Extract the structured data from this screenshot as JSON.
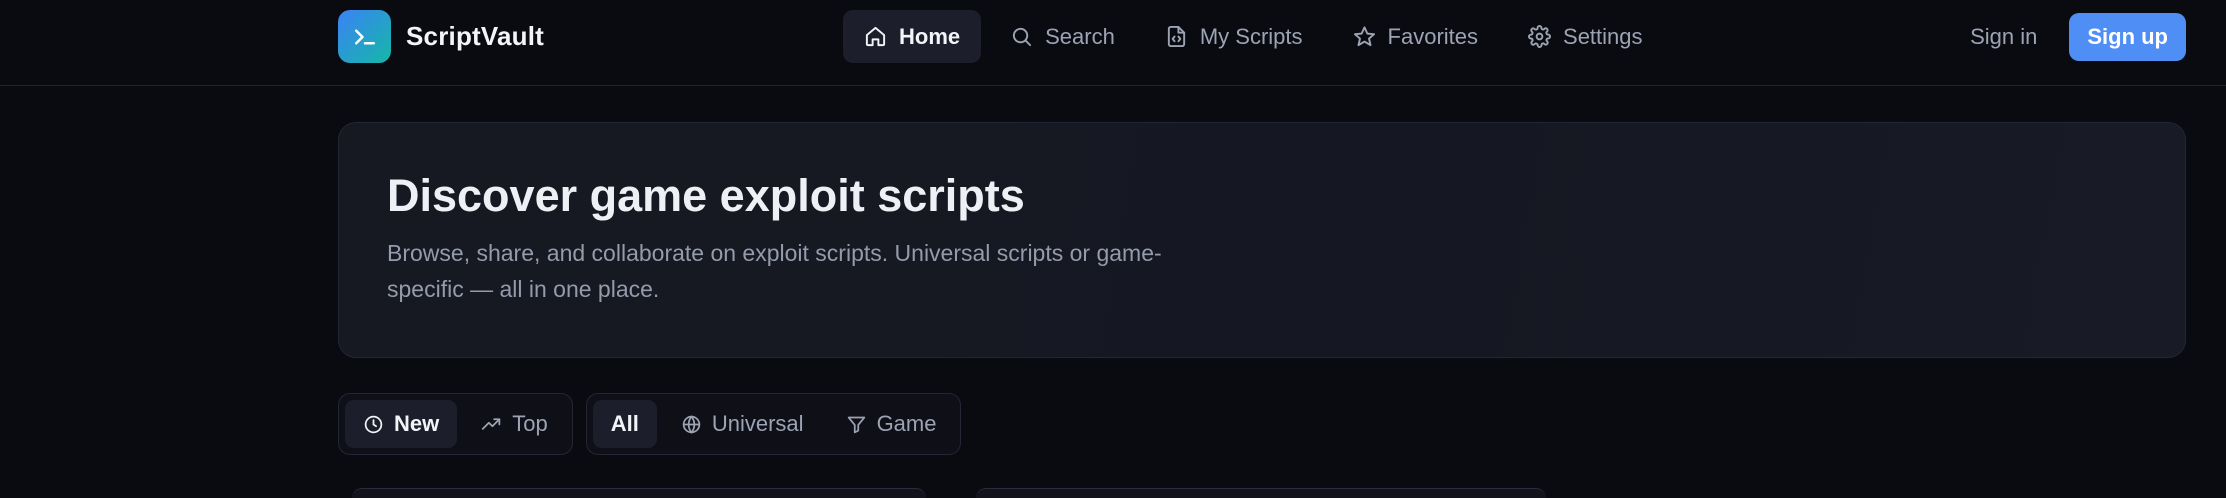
{
  "brand": {
    "name": "ScriptVault",
    "logo_icon": "terminal-icon",
    "gradient_from": "#3b82f6",
    "gradient_to": "#14b8a6"
  },
  "nav": {
    "items": [
      {
        "label": "Home",
        "icon": "home-icon",
        "active": true
      },
      {
        "label": "Search",
        "icon": "search-icon",
        "active": false
      },
      {
        "label": "My Scripts",
        "icon": "file-code-icon",
        "active": false
      },
      {
        "label": "Favorites",
        "icon": "star-icon",
        "active": false
      },
      {
        "label": "Settings",
        "icon": "gear-icon",
        "active": false
      }
    ]
  },
  "auth": {
    "sign_in": "Sign in",
    "sign_up": "Sign up",
    "accent": "#4f8ff5"
  },
  "hero": {
    "title": "Discover game exploit scripts",
    "description": "Browse, share, and collaborate on exploit scripts. Universal scripts or game-specific — all in one place."
  },
  "filters": {
    "sort": [
      {
        "label": "New",
        "icon": "clock-icon",
        "active": true
      },
      {
        "label": "Top",
        "icon": "trending-up-icon",
        "active": false
      }
    ],
    "type": [
      {
        "label": "All",
        "icon": "",
        "active": true
      },
      {
        "label": "Universal",
        "icon": "globe-icon",
        "active": false
      },
      {
        "label": "Game",
        "icon": "filter-icon",
        "active": false
      }
    ]
  },
  "colors": {
    "background": "#0a0b10",
    "card": "#161822",
    "border": "#232634",
    "muted_text": "#9ca3b4"
  }
}
